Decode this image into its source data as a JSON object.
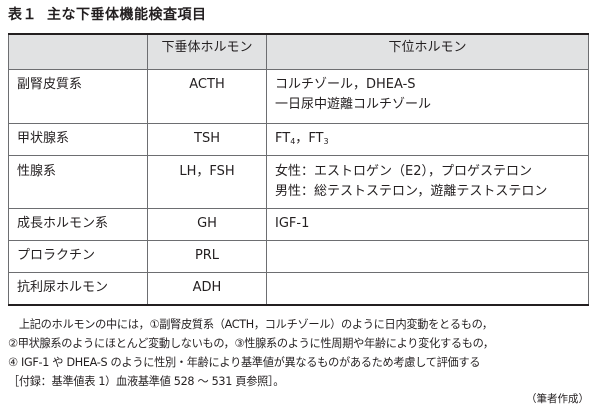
{
  "title": {
    "number": "表１",
    "text": "主な下垂体機能検査項目"
  },
  "table": {
    "headers": [
      "",
      "下垂体ホルモン",
      "下位ホルモン"
    ],
    "rows": [
      {
        "system": "副腎皮質系",
        "pituitary": "ACTH",
        "downstream": [
          "コルチゾール，DHEA-S",
          "一日尿中遊離コルチゾール"
        ]
      },
      {
        "system": "甲状腺系",
        "pituitary": "TSH",
        "downstream": [
          "FT4，FT3"
        ]
      },
      {
        "system": "性腺系",
        "pituitary": "LH，FSH",
        "downstream": [
          "女性：エストロゲン（E2），プロゲステロン",
          "男性：総テストステロン，遊離テストステロン"
        ]
      },
      {
        "system": "成長ホルモン系",
        "pituitary": "GH",
        "downstream": [
          "IGF-1"
        ]
      },
      {
        "system": "プロラクチン",
        "pituitary": "PRL",
        "downstream": [
          ""
        ]
      },
      {
        "system": "抗利尿ホルモン",
        "pituitary": "ADH",
        "downstream": [
          ""
        ]
      }
    ],
    "ft_parts": {
      "ft4_base": "FT",
      "ft4_sub": "4",
      "separator": "，",
      "ft3_base": "FT",
      "ft3_sub": "3"
    }
  },
  "footnote": [
    "　上記のホルモンの中には，①副腎皮質系（ACTH，コルチゾール）のように日内変動をとるもの，",
    "②甲状腺系のようにほとんど変動しないもの，③性腺系のように性周期や年齢により変化するもの，",
    "④ IGF-1 や DHEA-S のように性別・年齢により基準値が異なるものがあるため考慮して評価する",
    "［付録：基準値表 1）血液基準値 528 ～ 531 頁参照］。"
  ],
  "credit": "（筆者作成）"
}
